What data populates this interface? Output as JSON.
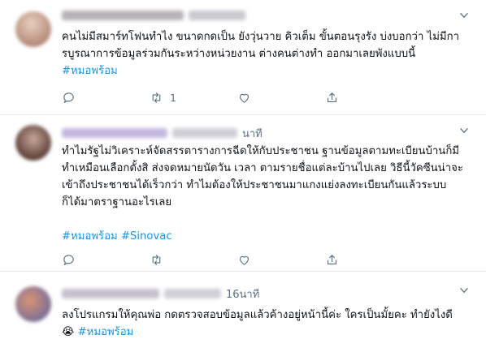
{
  "tweets": [
    {
      "time": "",
      "text": "คนไม่มีสมาร์ทโฟนทำไง ขนาดกดเป็น ยังวุ่นวาย คิวเต็ม ขั้นตอนรุงรัง บ่งบอกว่า ไม่มีการบูรณาการข้อมูลร่วมกันระหว่างหน่วยงาน ต่างคนต่างทำ ออกมาเลยพังแบบนี้",
      "hashtags": [
        "#หมอพร้อม"
      ],
      "retweets": "1",
      "avatar_colors": [
        "#d9b9a7",
        "#a77c68"
      ]
    },
    {
      "time": "นาที",
      "text": "ทำไมรัฐไม่วิเคราะห์จัดสรรตารางการฉีดให้กับประชาชน ฐานข้อมูลตามทะเบียนบ้านก็มี ทำเหมือนเลือกตั้งสิ ส่งจดหมายนัดวัน เวลา ตามรายชื่อแต่ละบ้านไปเลย วิธีนี้วัคซีนน่าจะเข้าถึงประชาชนได้เร็วกว่า ทำไมต้องให้ประชาชนมาแกงแย่งลงทะเบียนกันแล้วระบบก็ได้มาตราฐานอะไรเลย",
      "hashtags": [
        "#หมอพร้อม",
        "#Sinovac"
      ],
      "retweets": "",
      "avatar_colors": [
        "#6e4e45",
        "#c79f8e"
      ]
    },
    {
      "time": "16นาที",
      "text": "ลงโปรแกรมให้คุณพ่อ กดตรวจสอบข้อมูลแล้วค้างอยู่หน้านี้ค่ะ ใครเป็นมั้ยคะ ทำยังไงดี😭",
      "hashtags": [
        "#หมอพร้อม"
      ],
      "retweets": "",
      "avatar_colors": [
        "#8d7fa0",
        "#c87a5a"
      ]
    }
  ],
  "icons": {
    "caret": "chevron-down-icon",
    "reply": "reply-icon",
    "retweet": "retweet-icon",
    "like": "heart-icon",
    "share": "share-icon"
  },
  "colors": {
    "hashtag": "#1b95e0",
    "muted": "#5b7083",
    "divider": "#e6ecf0"
  }
}
